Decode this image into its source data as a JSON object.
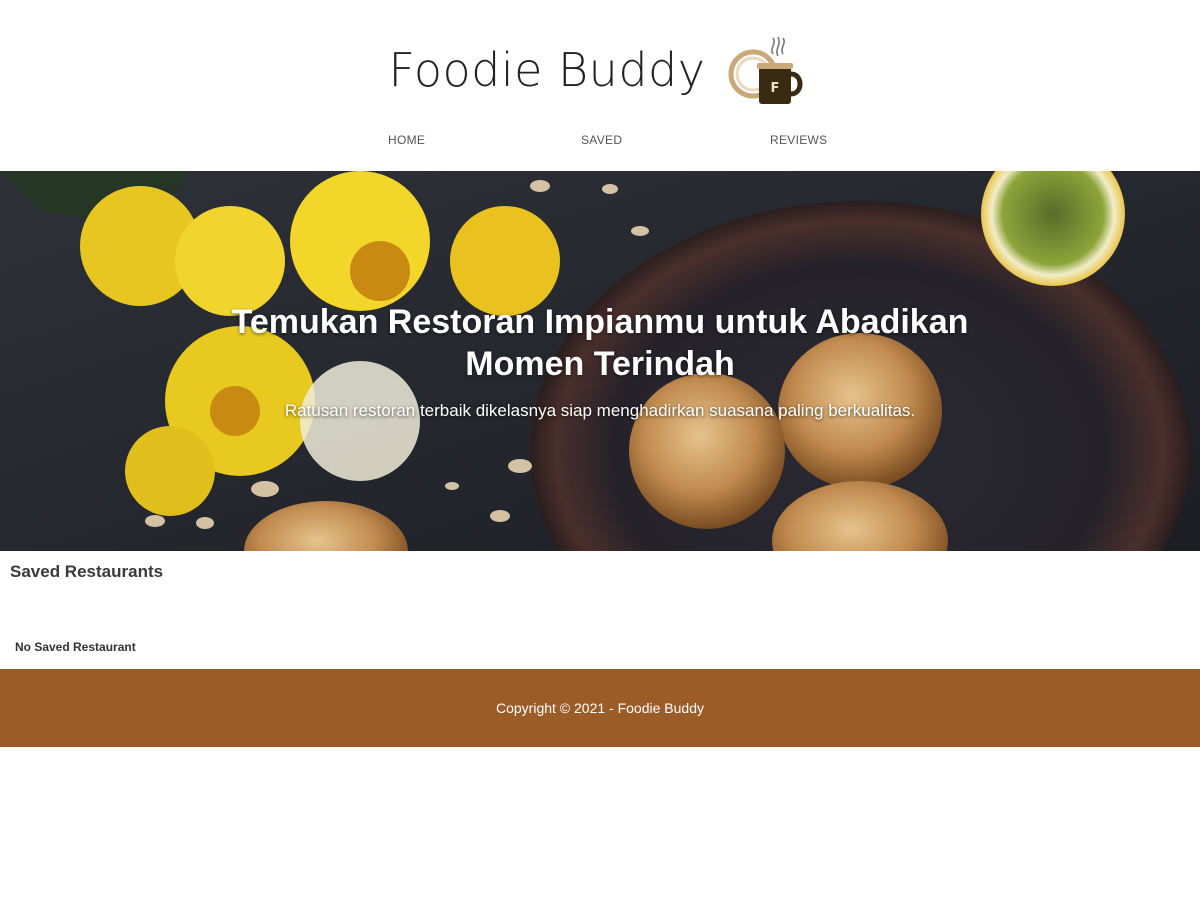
{
  "colors": {
    "accent": "#9c5c28",
    "text_dark": "#222222",
    "footer_bg": "#9c5c28",
    "footer_text": "#ffffff"
  },
  "header": {
    "brand_title": "Foodie Buddy",
    "logo_icon": "coffee-cup-logo-icon",
    "logo_letter": "F"
  },
  "nav": {
    "items": [
      {
        "label": "HOME"
      },
      {
        "label": "SAVED"
      },
      {
        "label": "REVIEWS"
      }
    ]
  },
  "hero": {
    "title": "Temukan Restoran Impianmu untuk Abadikan Momen Terindah",
    "tagline": "Ratusan restoran terbaik dikelasnya siap menghadirkan suasana paling berkualitas."
  },
  "saved": {
    "heading": "Saved Restaurants",
    "empty_message": "No Saved Restaurant"
  },
  "footer": {
    "copyright": "Copyright © 2021 - Foodie Buddy"
  }
}
